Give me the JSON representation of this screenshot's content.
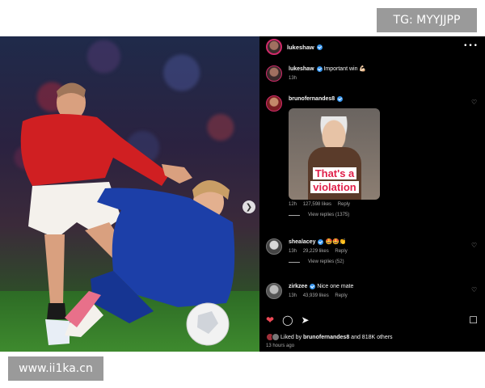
{
  "watermarks": {
    "top_right": "TG: MYYJJPP",
    "bottom_left": "www.ii1ka.cn"
  },
  "post": {
    "author": "lukeshaw",
    "caption_author": "lukeshaw",
    "caption_text": "Important win 💪🏻",
    "caption_time": "13h"
  },
  "comments": [
    {
      "user": "brunofernandes8",
      "gif_caption": [
        "That's a",
        "violation"
      ],
      "time": "12h",
      "likes": "127,598 likes",
      "reply": "Reply",
      "view_replies": "View replies (1375)"
    },
    {
      "user": "shealacey",
      "text": "🤩🤩👏",
      "time": "13h",
      "likes": "29,229 likes",
      "reply": "Reply",
      "view_replies": "View replies (52)"
    },
    {
      "user": "zirkzee",
      "text": "Nice one mate",
      "time": "13h",
      "likes": "43,939 likes",
      "reply": "Reply"
    }
  ],
  "footer": {
    "liked_prefix": "Liked by",
    "liked_user": "brunofernandes8",
    "liked_suffix": "and 818K others",
    "timestamp": "13 hours ago"
  },
  "colors": {
    "panel_bg": "#000000",
    "verified": "#3897f0",
    "like_red": "#ed4956",
    "muted": "#a8a8a8",
    "watermark_bg": "#9a9a9a"
  },
  "icons": [
    "more-icon",
    "heart-icon",
    "comment-icon",
    "share-icon",
    "bookmark-icon",
    "next-arrow-icon"
  ]
}
